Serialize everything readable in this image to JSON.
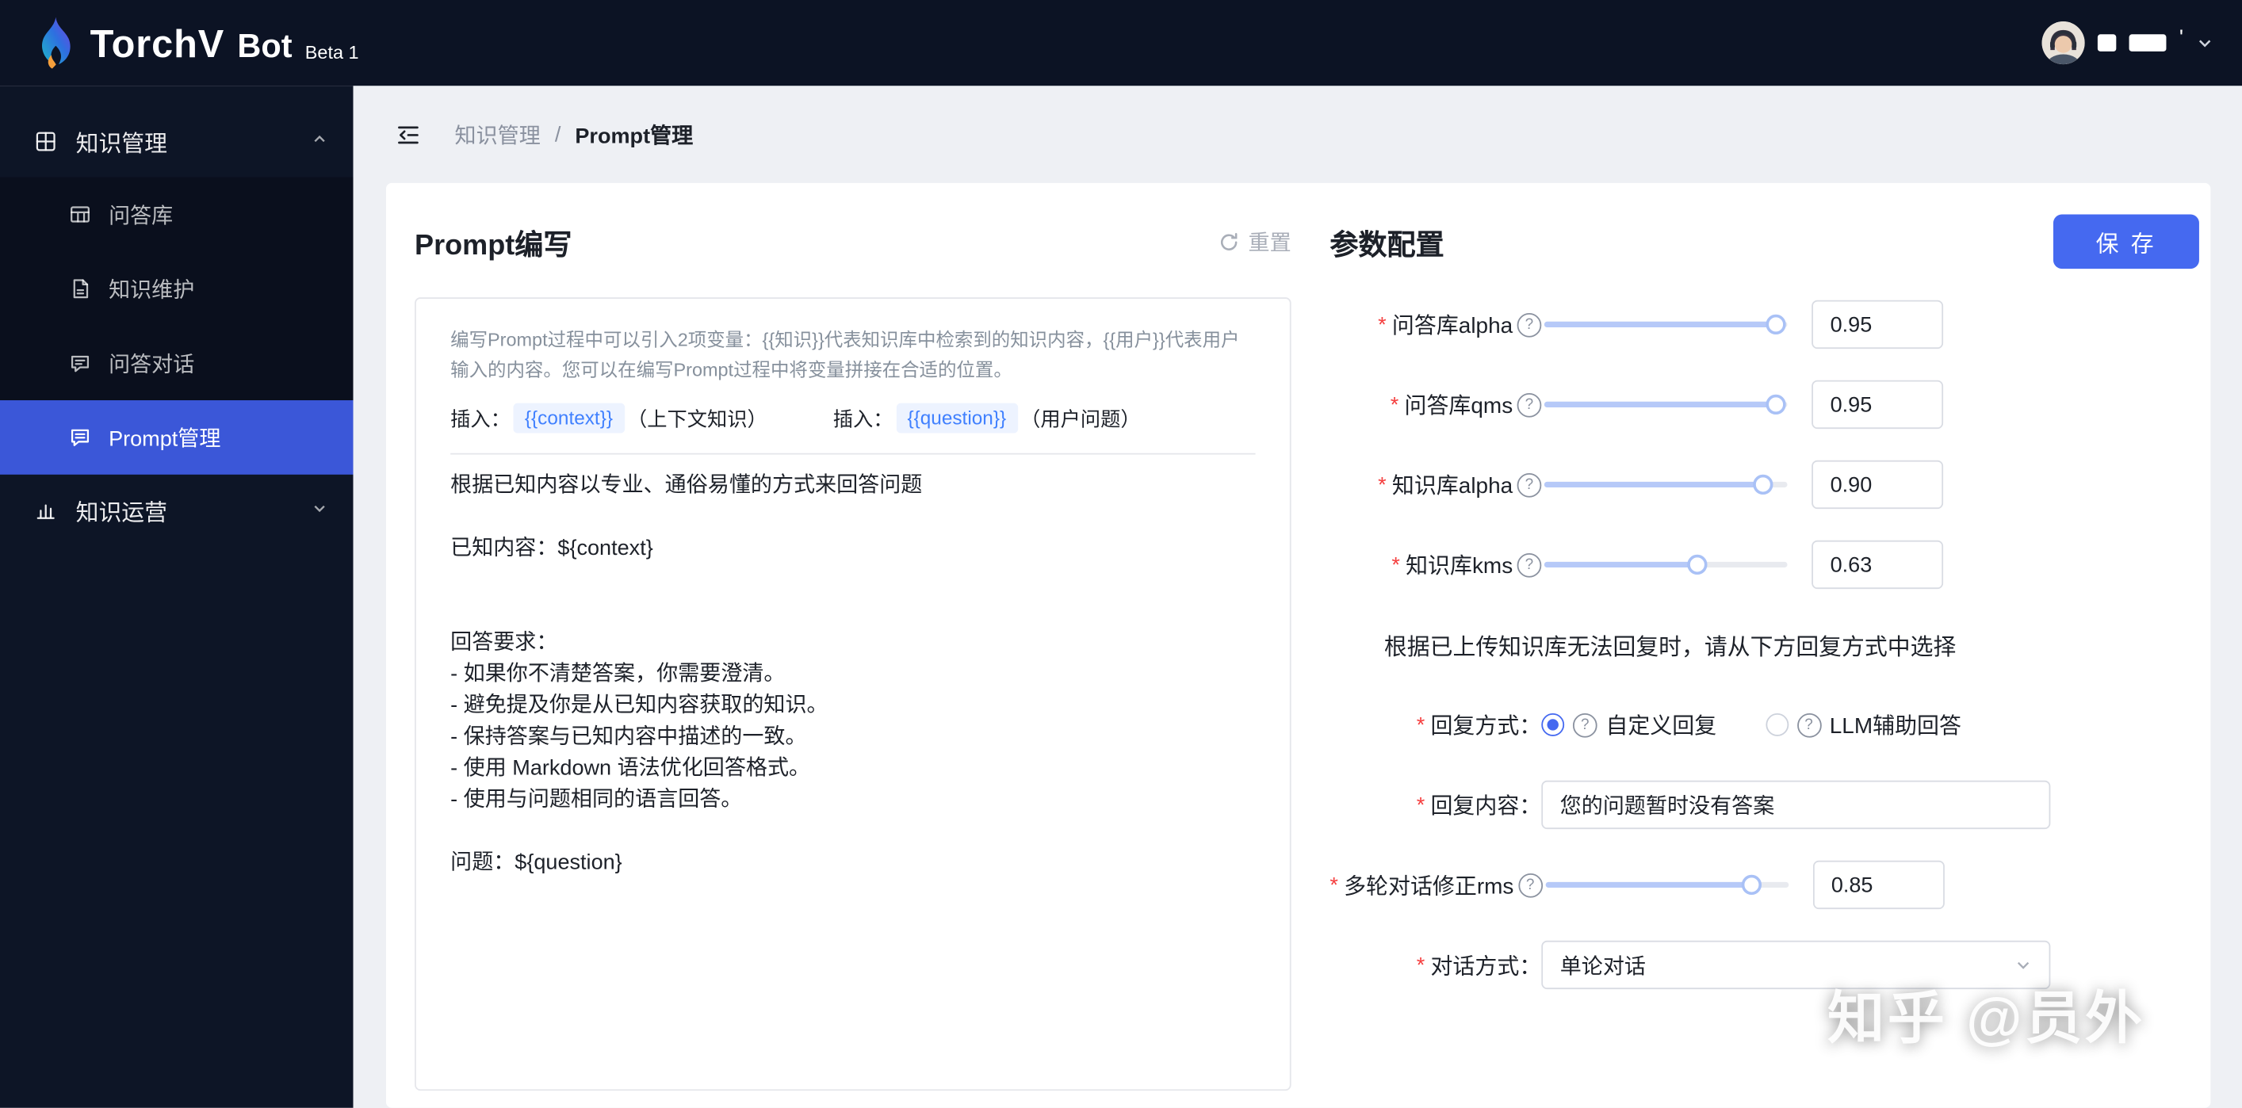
{
  "app": {
    "brand": "TorchV",
    "brand_suffix": "Bot",
    "beta_tag": "Beta 1"
  },
  "sidebar": {
    "group1": {
      "label": "知识管理",
      "items": [
        {
          "label": "问答库"
        },
        {
          "label": "知识维护"
        },
        {
          "label": "问答对话"
        },
        {
          "label": "Prompt管理"
        }
      ]
    },
    "group2": {
      "label": "知识运营"
    }
  },
  "breadcrumb": {
    "level1": "知识管理",
    "divider": "/",
    "level2": "Prompt管理"
  },
  "prompt_panel": {
    "title": "Prompt编写",
    "reset_label": "重置",
    "help_text": "编写Prompt过程中可以引入2项变量：{{知识}}代表知识库中检索到的知识内容，{{用户}}代表用户输入的内容。您可以在编写Prompt过程中将变量拼接在合适的位置。",
    "insert_label1": "插入：",
    "context_tag": "{{context}}",
    "context_desc": "（上下文知识）",
    "insert_label2": "插入：",
    "question_tag": "{{question}}",
    "question_desc": "（用户问题）",
    "prompt_text": "根据已知内容以专业、通俗易懂的方式来回答问题\n\n已知内容：${context}\n\n\n回答要求：\n- 如果你不清楚答案，你需要澄清。\n- 避免提及你是从已知内容获取的知识。\n- 保持答案与已知内容中描述的一致。\n- 使用 Markdown 语法优化回答格式。\n- 使用与问题相同的语言回答。\n\n问题：${question}"
  },
  "params_panel": {
    "title": "参数配置",
    "save_label": "保 存",
    "sliders": [
      {
        "label": "问答库alpha",
        "value": "0.95",
        "percent": 95
      },
      {
        "label": "问答库qms",
        "value": "0.95",
        "percent": 95
      },
      {
        "label": "知识库alpha",
        "value": "0.90",
        "percent": 90
      },
      {
        "label": "知识库kms",
        "value": "0.63",
        "percent": 63
      }
    ],
    "fallback_notice": "根据已上传知识库无法回复时，请从下方回复方式中选择",
    "reply_mode_label": "回复方式：",
    "reply_options": [
      {
        "label": "自定义回复"
      },
      {
        "label": "LLM辅助回答"
      }
    ],
    "reply_content_label": "回复内容：",
    "reply_content_value": "您的问题暂时没有答案",
    "multi_turn": {
      "label": "多轮对话修正rms",
      "value": "0.85",
      "percent": 85
    },
    "dialog_mode_label": "对话方式：",
    "dialog_mode_value": "单论对话"
  },
  "watermark": "知乎 @员外",
  "colors": {
    "primary": "#4569f0",
    "sidebar_selected": "#3b57d8",
    "required_mark": "#f53f3f",
    "tag_text": "#4080ff"
  }
}
